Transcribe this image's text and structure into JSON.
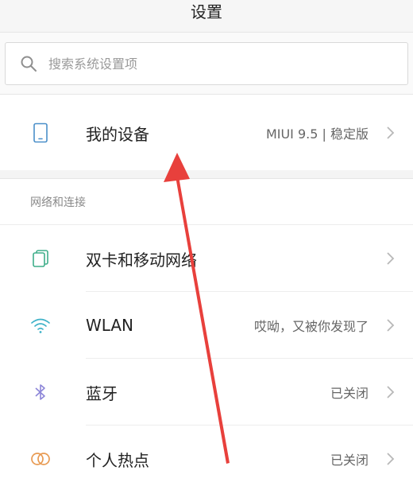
{
  "header": {
    "title": "设置"
  },
  "search": {
    "placeholder": "搜索系统设置项"
  },
  "device": {
    "label": "我的设备",
    "value": "MIUI 9.5 | 稳定版",
    "icon": "phone-icon"
  },
  "network": {
    "section_title": "网络和连接",
    "items": [
      {
        "label": "双卡和移动网络",
        "value": "",
        "icon": "sim-card-icon"
      },
      {
        "label": "WLAN",
        "value": "哎呦，又被你发现了",
        "icon": "wifi-icon"
      },
      {
        "label": "蓝牙",
        "value": "已关闭",
        "icon": "bluetooth-icon"
      },
      {
        "label": "个人热点",
        "value": "已关闭",
        "icon": "hotspot-icon"
      }
    ]
  },
  "annotation": {
    "arrow_color": "#e8403c"
  }
}
